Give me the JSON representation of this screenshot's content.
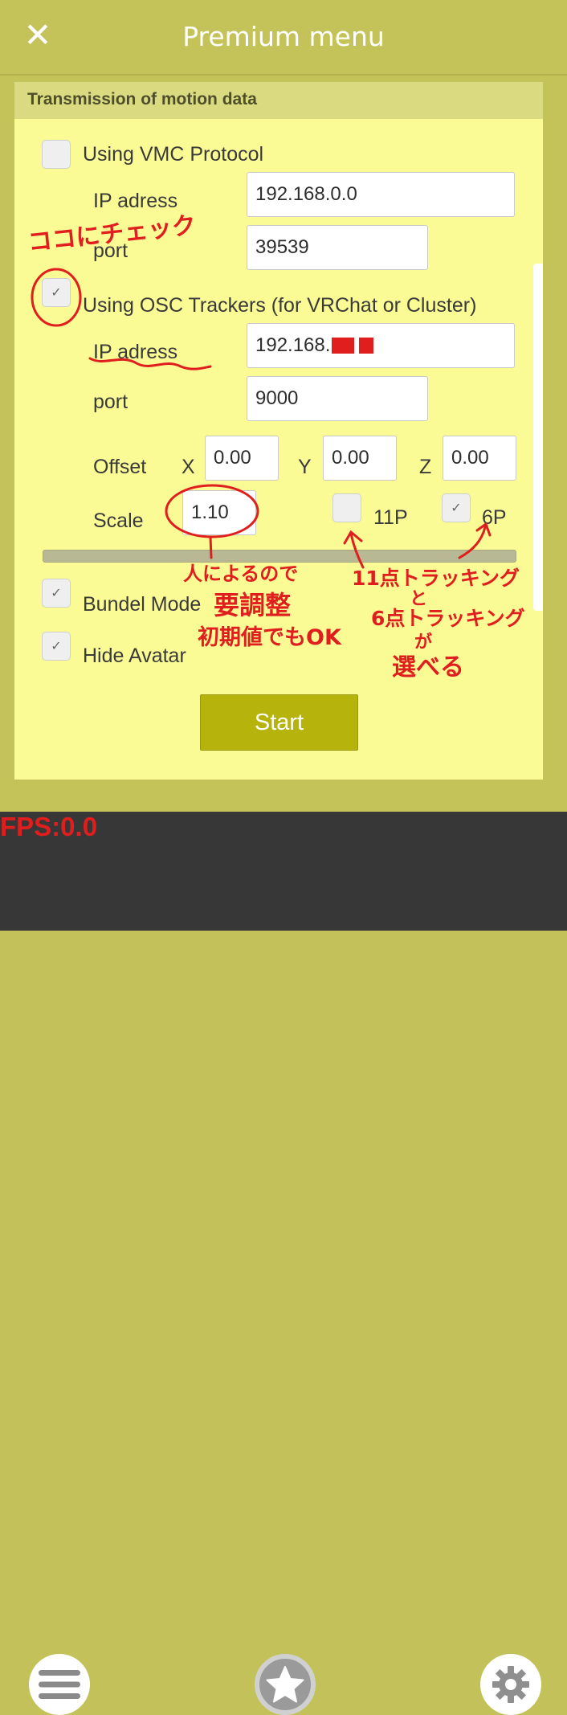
{
  "header": {
    "close_glyph": "✕",
    "title": "Premium menu"
  },
  "section": {
    "title": "Transmission of motion data"
  },
  "vmc": {
    "label": "Using VMC Protocol",
    "checked": false,
    "ip_label": "IP adress",
    "ip_value": "192.168.0.0",
    "port_label": "port",
    "port_value": "39539"
  },
  "osc": {
    "label": "Using OSC Trackers (for VRChat or Cluster)",
    "checked": true,
    "ip_label": "IP adress",
    "ip_value": "192.168.",
    "port_label": "port",
    "port_value": "9000"
  },
  "offset": {
    "label": "Offset",
    "x_label": "X",
    "x_value": "0.00",
    "y_label": "Y",
    "y_value": "0.00",
    "z_label": "Z",
    "z_value": "0.00"
  },
  "scale": {
    "label": "Scale",
    "value": "1.10"
  },
  "points": {
    "p11_label": "11P",
    "p11_checked": false,
    "p6_label": "6P",
    "p6_checked": true
  },
  "bundel": {
    "label": "Bundel Mode",
    "checked": true
  },
  "hide": {
    "label": "Hide Avatar",
    "checked": true
  },
  "start_label": "Start",
  "fps": "FPS:0.0",
  "checkmark": "✓",
  "annotations": {
    "check_here": "ココにチェック",
    "per_person_1": "人によるので",
    "per_person_2": "要調整",
    "per_person_3": "初期値でもOK",
    "tracking_1": "11点トラッキング",
    "tracking_2": "と",
    "tracking_3": "6点トラッキング",
    "tracking_4": "が",
    "tracking_5": "選べる"
  },
  "icons": {
    "menu": "hamburger-icon",
    "favorite": "star-icon",
    "settings": "gear-icon"
  },
  "colors": {
    "header": "#c4c35a",
    "panel": "#fbfb96",
    "start": "#b6b30c",
    "annotation": "#e01e1e"
  }
}
